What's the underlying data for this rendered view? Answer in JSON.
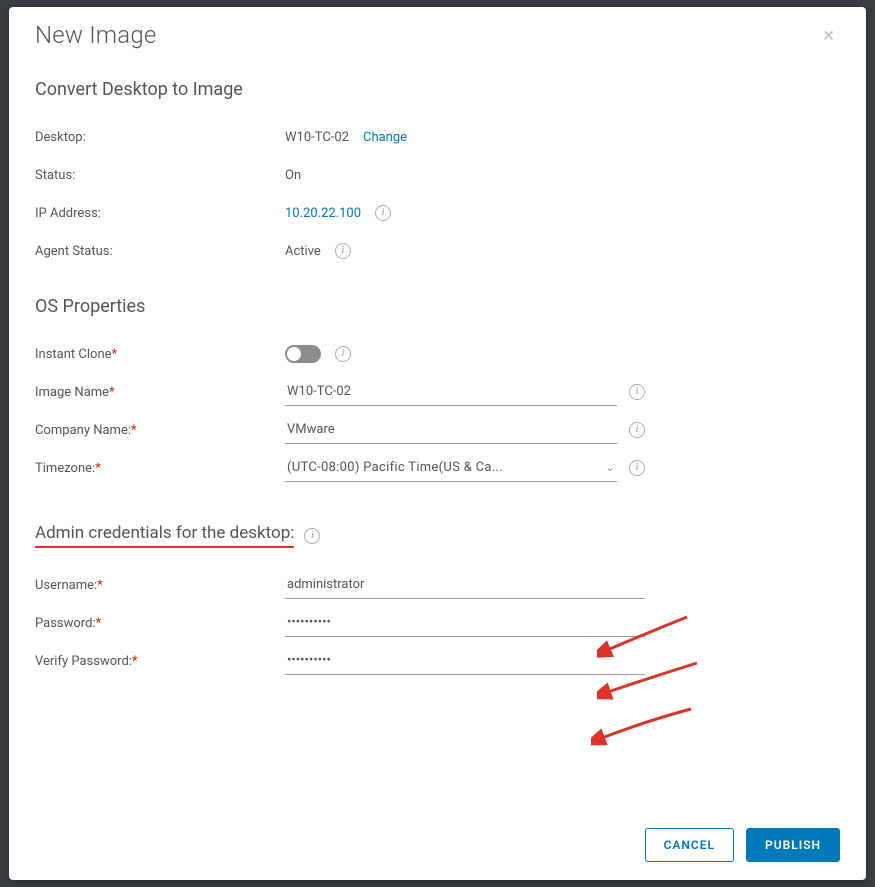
{
  "modal": {
    "title": "New Image",
    "close_label": "×"
  },
  "section1": {
    "title": "Convert Desktop to Image",
    "desktop_label": "Desktop:",
    "desktop_value": "W10-TC-02",
    "change_link": "Change",
    "status_label": "Status:",
    "status_value": "On",
    "ip_label": "IP Address:",
    "ip_value": "10.20.22.100",
    "agent_label": "Agent Status:",
    "agent_value": "Active"
  },
  "section2": {
    "title": "OS Properties",
    "instant_clone_label": "Instant Clone",
    "instant_clone_on": false,
    "image_name_label": "Image Name",
    "image_name_value": "W10-TC-02",
    "company_label": "Company Name:",
    "company_value": "VMware",
    "timezone_label": "Timezone:",
    "timezone_value": "(UTC-08:00) Pacific Time(US & Ca..."
  },
  "section3": {
    "title": "Admin credentials for the desktop:",
    "username_label": "Username:",
    "username_value": "administrator",
    "password_label": "Password:",
    "password_value": "••••••••••",
    "verify_label": "Verify Password:",
    "verify_value": "••••••••••"
  },
  "footer": {
    "cancel": "CANCEL",
    "publish": "PUBLISH"
  },
  "annotation_color": "#d9342b"
}
